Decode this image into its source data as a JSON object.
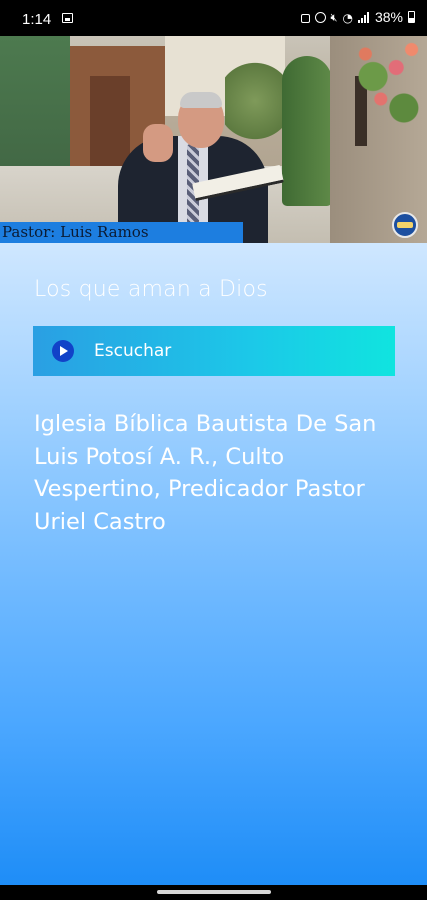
{
  "status_bar": {
    "time": "1:14",
    "battery": "38%",
    "icons": [
      "image-icon",
      "lock-icon",
      "alarm-icon",
      "mute-icon",
      "wifi-icon",
      "signal-icon",
      "battery-icon"
    ]
  },
  "hero": {
    "caption": "Pastor: Luis Ramos"
  },
  "main": {
    "title": "Los que aman a Dios",
    "listen_label": "Escuchar",
    "description": "Iglesia Bíblica Bautista De San Luis Potosí A. R., Culto Vespertino, Predicador Pastor Uriel Castro"
  },
  "colors": {
    "accent_start": "#2a9fe3",
    "accent_end": "#10e4df",
    "play_icon": "#1142c8",
    "background_top": "#cfe7ff",
    "background_bottom": "#1e8df7"
  }
}
